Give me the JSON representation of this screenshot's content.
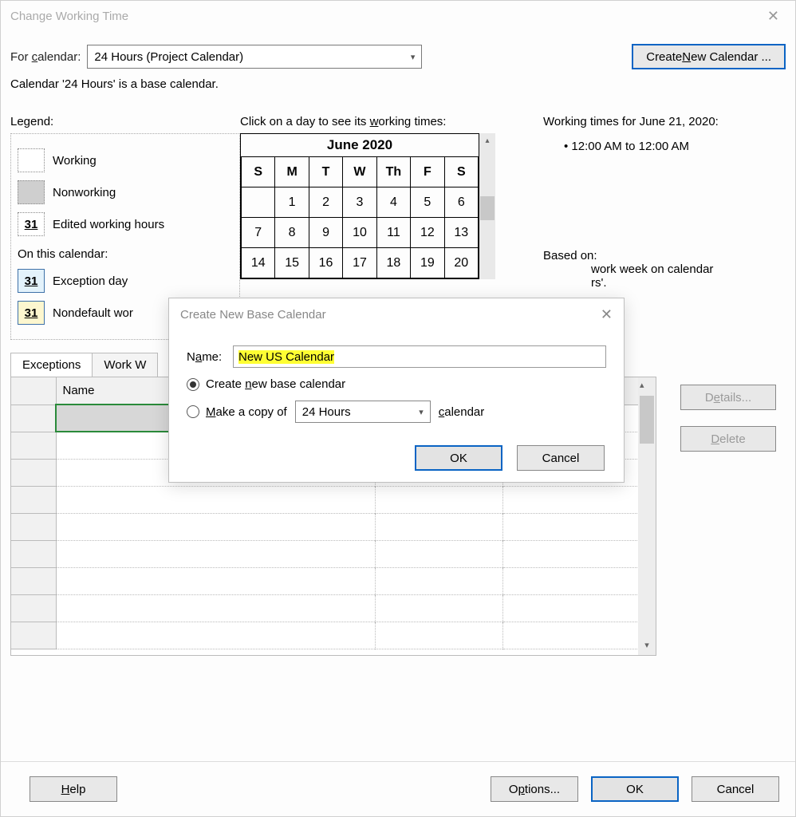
{
  "title": "Change Working Time",
  "for_calendar_label": "For calendar:",
  "for_calendar_value": "24 Hours (Project Calendar)",
  "create_new_btn": "Create New Calendar ...",
  "hint": "Calendar '24 Hours' is a base calendar.",
  "legend": {
    "title": "Legend:",
    "working": "Working",
    "nonworking": "Nonworking",
    "edited": "Edited working hours",
    "sub": "On this calendar:",
    "exception": "Exception day",
    "nondefault": "Nondefault wor",
    "num": "31"
  },
  "calendar": {
    "click_label": "Click on a day to see its working times:",
    "month": "June 2020",
    "dow": [
      "S",
      "M",
      "T",
      "W",
      "Th",
      "F",
      "S"
    ],
    "rows": [
      [
        "",
        "1",
        "2",
        "3",
        "4",
        "5",
        "6"
      ],
      [
        "7",
        "8",
        "9",
        "10",
        "11",
        "12",
        "13"
      ],
      [
        "14",
        "15",
        "16",
        "17",
        "18",
        "19",
        "20"
      ]
    ]
  },
  "info": {
    "wt_title": "Working times for June 21, 2020:",
    "wt_value": "• 12:00 AM to 12:00 AM",
    "based_on_label": "Based on:",
    "based_on_text1": "work week on calendar",
    "based_on_text2": "rs'."
  },
  "tabs": {
    "exceptions": "Exceptions",
    "workweeks": "Work W"
  },
  "grid": {
    "name_col": "Name"
  },
  "side": {
    "details": "Details...",
    "delete": "Delete"
  },
  "bottom": {
    "help": "Help",
    "options": "Options...",
    "ok": "OK",
    "cancel": "Cancel"
  },
  "modal": {
    "title": "Create New Base Calendar",
    "name_label": "Name:",
    "name_value": "New US Calendar",
    "opt_new": "Create new base calendar",
    "opt_copy": "Make a copy of",
    "copy_value": "24 Hours",
    "calendar_word": "calendar",
    "ok": "OK",
    "cancel": "Cancel"
  }
}
